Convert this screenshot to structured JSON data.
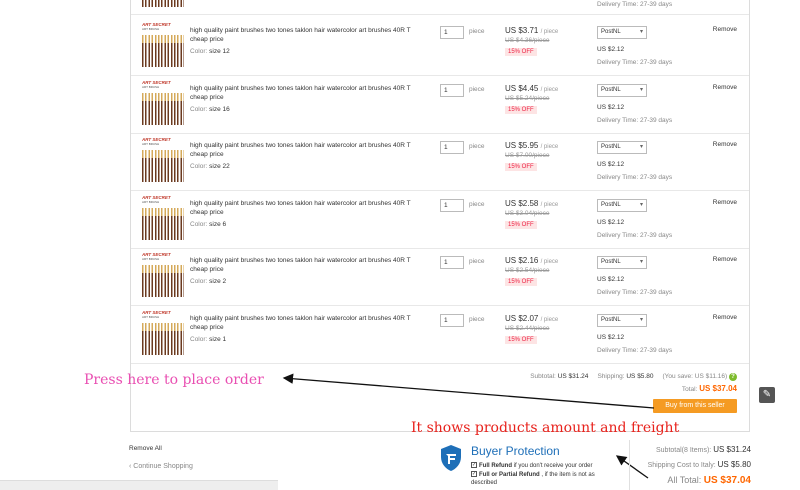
{
  "top_row": {
    "delivery_label": "Delivery Time:",
    "delivery_value": "27-39 days"
  },
  "product": {
    "brand": "ART SECRET",
    "sub": "ART BRUSH"
  },
  "items": [
    {
      "title": "high quality paint brushes two tones taklon hair watercolor art brushes 40R T cheap price",
      "color_label": "Color:",
      "color": "size 12",
      "qty": "1",
      "unit": "piece",
      "price": "US $3.71",
      "per": "/ piece",
      "old_price": "US $4.36/piece",
      "discount": "15% OFF",
      "shipping_method": "PostNL",
      "shipping_cost": "US $2.12",
      "delivery_label": "Delivery Time:",
      "delivery": "27-39 days",
      "remove": "Remove"
    },
    {
      "title": "high quality paint brushes two tones taklon hair watercolor art brushes 40R T cheap price",
      "color_label": "Color:",
      "color": "size 16",
      "qty": "1",
      "unit": "piece",
      "price": "US $4.45",
      "per": "/ piece",
      "old_price": "US $5.24/piece",
      "discount": "15% OFF",
      "shipping_method": "PostNL",
      "shipping_cost": "US $2.12",
      "delivery_label": "Delivery Time:",
      "delivery": "27-39 days",
      "remove": "Remove"
    },
    {
      "title": "high quality paint brushes two tones taklon hair watercolor art brushes 40R T cheap price",
      "color_label": "Color:",
      "color": "size 22",
      "qty": "1",
      "unit": "piece",
      "price": "US $5.95",
      "per": "/ piece",
      "old_price": "US $7.00/piece",
      "discount": "15% OFF",
      "shipping_method": "PostNL",
      "shipping_cost": "US $2.12",
      "delivery_label": "Delivery Time:",
      "delivery": "27-39 days",
      "remove": "Remove"
    },
    {
      "title": "high quality paint brushes two tones taklon hair watercolor art brushes 40R T cheap price",
      "color_label": "Color:",
      "color": "size 6",
      "qty": "1",
      "unit": "piece",
      "price": "US $2.58",
      "per": "/ piece",
      "old_price": "US $3.04/piece",
      "discount": "15% OFF",
      "shipping_method": "PostNL",
      "shipping_cost": "US $2.12",
      "delivery_label": "Delivery Time:",
      "delivery": "27-39 days",
      "remove": "Remove"
    },
    {
      "title": "high quality paint brushes two tones taklon hair watercolor art brushes 40R T cheap price",
      "color_label": "Color:",
      "color": "size 2",
      "qty": "1",
      "unit": "piece",
      "price": "US $2.16",
      "per": "/ piece",
      "old_price": "US $2.54/piece",
      "discount": "15% OFF",
      "shipping_method": "PostNL",
      "shipping_cost": "US $2.12",
      "delivery_label": "Delivery Time:",
      "delivery": "27-39 days",
      "remove": "Remove"
    },
    {
      "title": "high quality paint brushes two tones taklon hair watercolor art brushes 40R T cheap price",
      "color_label": "Color:",
      "color": "size 1",
      "qty": "1",
      "unit": "piece",
      "price": "US $2.07",
      "per": "/ piece",
      "old_price": "US $2.44/piece",
      "discount": "15% OFF",
      "shipping_method": "PostNL",
      "shipping_cost": "US $2.12",
      "delivery_label": "Delivery Time:",
      "delivery": "27-39 days",
      "remove": "Remove"
    }
  ],
  "seller_totals": {
    "subtotal_label": "Subtotal:",
    "subtotal": "US $31.24",
    "shipping_label": "Shipping:",
    "shipping": "US $5.80",
    "save_text": "(You save: US $11.16",
    "save_close": ")",
    "help_icon": "?",
    "total_label": "Total:",
    "total": "US $37.04",
    "buy_button": "Buy from this seller"
  },
  "annotations": {
    "press_here": "Press here to place order",
    "shows_amount": "It shows products amount and freight"
  },
  "footer": {
    "remove_all": "Remove All",
    "continue_icon": "‹",
    "continue_shopping": "Continue Shopping"
  },
  "buyer_protection": {
    "title": "Buyer Protection",
    "line1_em": "Full Refund",
    "line1": " if you don't receive your order",
    "line2_em": "Full or Partial Refund",
    "line2": " , if the item is not as described",
    "check_glyph": "✓"
  },
  "order_summary": {
    "subtotal_label": "Subtotal(8 Items):",
    "subtotal": "US $31.24",
    "shipping_label": "Shipping Cost to Italy:",
    "shipping": "US $5.80",
    "total_label": "All Total:",
    "total": "US $37.04"
  },
  "edit_icon_glyph": "✎",
  "colors": {
    "accent_orange": "#f60",
    "button_orange": "#f59b23",
    "annotation_pink": "#e94fb2",
    "annotation_red": "#e8221c",
    "protection_blue": "#1e6fb8",
    "discount_red": "#e24"
  }
}
